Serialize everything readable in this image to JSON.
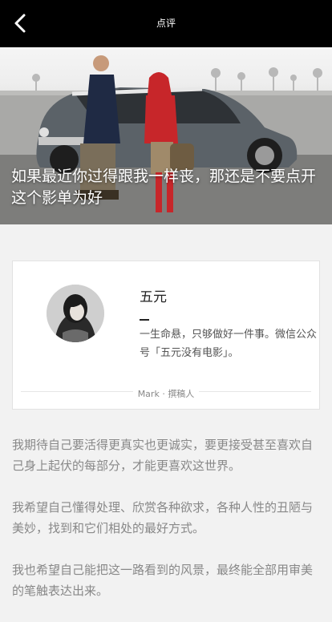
{
  "header": {
    "title": "点评",
    "back_icon": "chevron-left-icon"
  },
  "hero": {
    "caption": "如果最近你过得跟我一样丧，那还是不要点开这个影单为好"
  },
  "author": {
    "name": "五元",
    "bio": "一生命悬，只够做好一件事。微信公众号「五元没有电影」。",
    "mark_label": "Mark",
    "separator": "·",
    "role": "撰稿人"
  },
  "article": {
    "paragraphs": [
      "我期待自己要活得更真实也更诚实，要更接受甚至喜欢自己身上起伏的每部分，才能更喜欢这世界。",
      "我希望自己懂得处理、欣赏各种欲求，各种人性的丑陋与美妙，找到和它们相处的最好方式。",
      "我也希望自己能把这一路看到的风景，最终能全部用审美的笔触表达出来。"
    ]
  },
  "colors": {
    "topbar": "#000000",
    "page_bg": "#f2f2f2",
    "card_bg": "#ffffff",
    "body_text": "#888888",
    "bio_text": "#555555"
  }
}
